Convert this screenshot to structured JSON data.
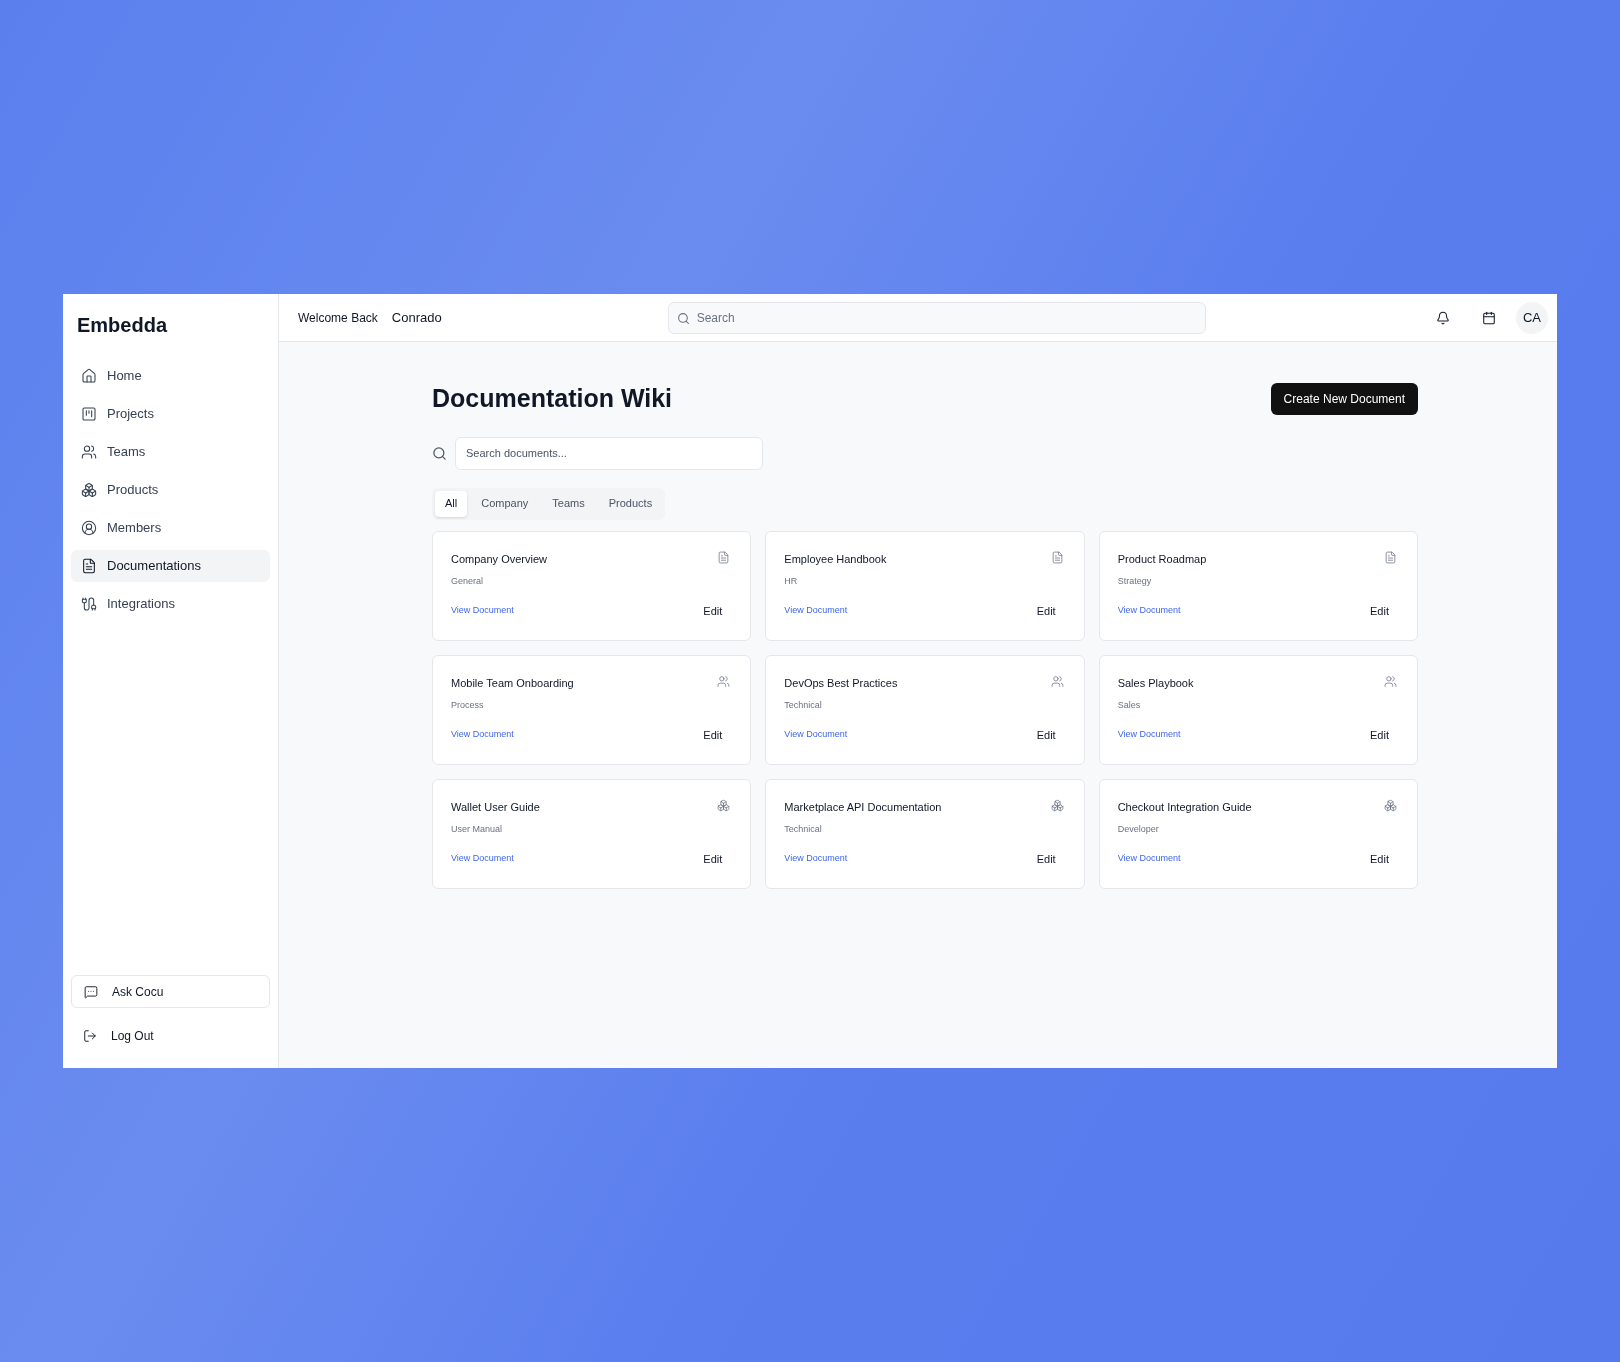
{
  "sidebar": {
    "brand": "Embedda",
    "items": [
      {
        "label": "Home",
        "selected": false
      },
      {
        "label": "Projects",
        "selected": false
      },
      {
        "label": "Teams",
        "selected": false
      },
      {
        "label": "Products",
        "selected": false
      },
      {
        "label": "Members",
        "selected": false
      },
      {
        "label": "Documentations",
        "selected": true
      },
      {
        "label": "Integrations",
        "selected": false
      }
    ],
    "ask": "Ask Cocu",
    "logout": "Log Out"
  },
  "topbar": {
    "welcome": "Welcome Back",
    "user": "Conrado",
    "search": {
      "placeholder": "Search"
    },
    "avatar": "CA"
  },
  "page": {
    "title": "Documentation Wiki",
    "create_button": "Create New Document",
    "search": {
      "placeholder": "Search documents..."
    },
    "tabs": [
      {
        "label": "All",
        "selected": true
      },
      {
        "label": "Company",
        "selected": false
      },
      {
        "label": "Teams",
        "selected": false
      },
      {
        "label": "Products",
        "selected": false
      }
    ],
    "documents": [
      {
        "kind": "company",
        "title": "Company Overview",
        "category": "General",
        "link": "View Document",
        "action": "Edit"
      },
      {
        "kind": "company",
        "title": "Employee Handbook",
        "category": "HR",
        "link": "View Document",
        "action": "Edit"
      },
      {
        "kind": "company",
        "title": "Product Roadmap",
        "category": "Strategy",
        "link": "View Document",
        "action": "Edit"
      },
      {
        "kind": "team",
        "title": "Mobile Team Onboarding",
        "category": "Process",
        "link": "View Document",
        "action": "Edit"
      },
      {
        "kind": "team",
        "title": "DevOps Best Practices",
        "category": "Technical",
        "link": "View Document",
        "action": "Edit"
      },
      {
        "kind": "team",
        "title": "Sales Playbook",
        "category": "Sales",
        "link": "View Document",
        "action": "Edit"
      },
      {
        "kind": "product",
        "title": "Wallet User Guide",
        "category": "User Manual",
        "link": "View Document",
        "action": "Edit"
      },
      {
        "kind": "product",
        "title": "Marketplace API Documentation",
        "category": "Technical",
        "link": "View Document",
        "action": "Edit"
      },
      {
        "kind": "product",
        "title": "Checkout Integration Guide",
        "category": "Developer",
        "link": "View Document",
        "action": "Edit"
      }
    ]
  }
}
